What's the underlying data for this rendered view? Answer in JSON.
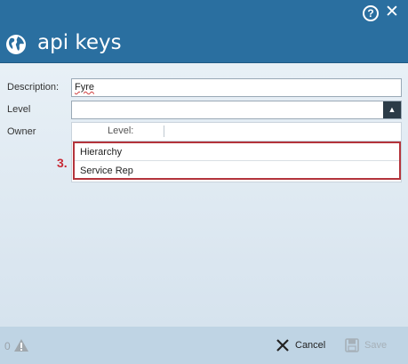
{
  "window": {
    "help_glyph": "?",
    "close_glyph": "✕",
    "title": "api keys"
  },
  "form": {
    "description_label": "Description:",
    "description_value": "Fyre",
    "level_label": "Level",
    "level_value": "",
    "owner_label": "Owner"
  },
  "dropdown": {
    "arrow_glyph": "▲",
    "column_header": "Level:",
    "options": [
      "Hierarchy",
      "Service Rep"
    ]
  },
  "annotation": {
    "step": "3."
  },
  "footer": {
    "warning_count": "0",
    "cancel_label": "Cancel",
    "save_label": "Save"
  },
  "colors": {
    "header_blue": "#2a6fa0",
    "highlight_red": "#b4343c",
    "step_red": "#c82a35"
  }
}
